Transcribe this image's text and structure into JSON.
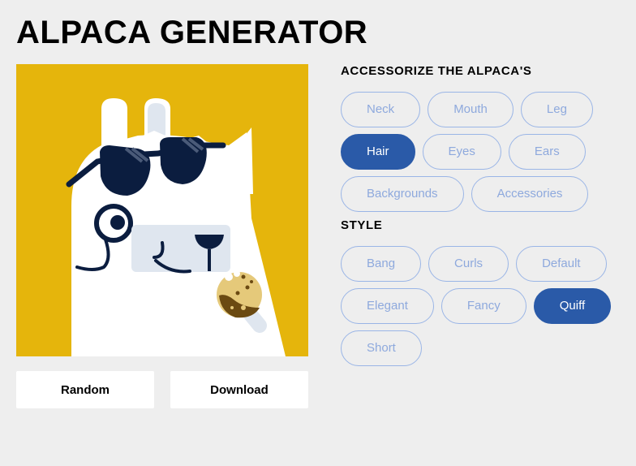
{
  "app": {
    "title": "ALPACA GENERATOR"
  },
  "preview": {
    "background_color": "#e5b50c",
    "hair": "Quiff",
    "accessory": "Glasses & cookie"
  },
  "actions": {
    "random_label": "Random",
    "download_label": "Download"
  },
  "accessorize": {
    "title": "ACCESSORIZE THE ALPACA'S",
    "items": [
      {
        "label": "Neck",
        "active": false
      },
      {
        "label": "Mouth",
        "active": false
      },
      {
        "label": "Leg",
        "active": false
      },
      {
        "label": "Hair",
        "active": true
      },
      {
        "label": "Eyes",
        "active": false
      },
      {
        "label": "Ears",
        "active": false
      },
      {
        "label": "Backgrounds",
        "active": false
      },
      {
        "label": "Accessories",
        "active": false
      }
    ]
  },
  "style": {
    "title": "STYLE",
    "items": [
      {
        "label": "Bang",
        "active": false
      },
      {
        "label": "Curls",
        "active": false
      },
      {
        "label": "Default",
        "active": false
      },
      {
        "label": "Elegant",
        "active": false
      },
      {
        "label": "Fancy",
        "active": false
      },
      {
        "label": "Quiff",
        "active": true
      },
      {
        "label": "Short",
        "active": false
      }
    ]
  },
  "colors": {
    "accent": "#2a5aa8",
    "chip_border": "#9ab5e6",
    "chip_text": "#8ea9dd",
    "page_background": "#eeeeee"
  }
}
